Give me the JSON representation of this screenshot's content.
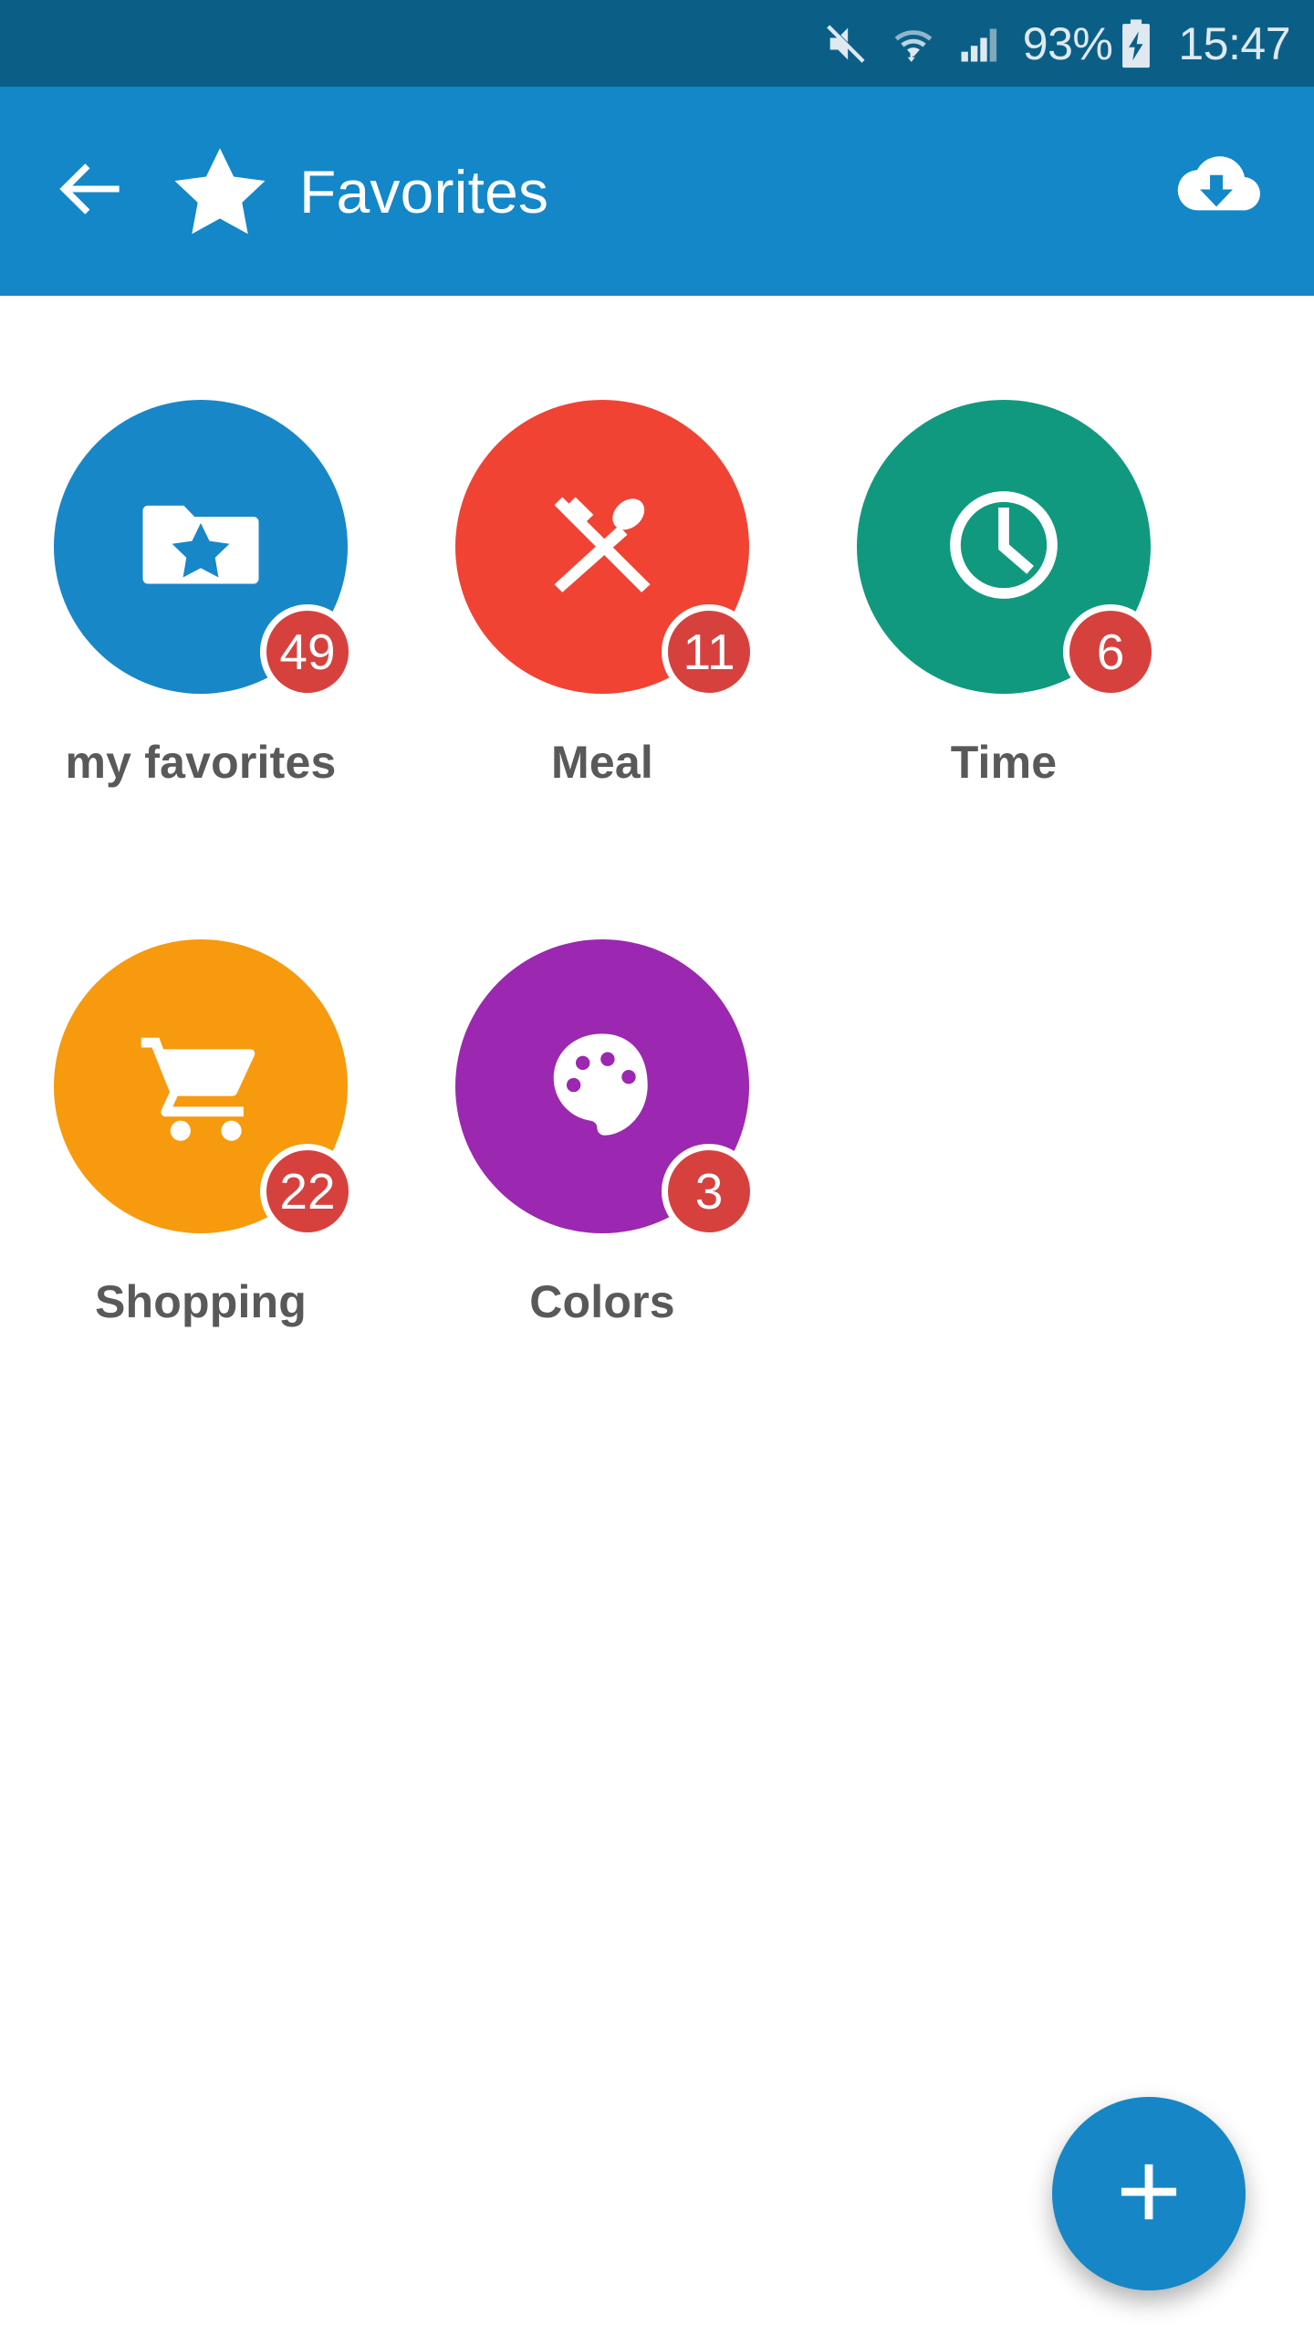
{
  "status_bar": {
    "background_color": "#0b5f87",
    "icons": [
      "mute-icon",
      "wifi-transfer-icon",
      "signal-bars-icon",
      "battery-charging-icon"
    ],
    "battery_percent": "93%",
    "clock": "15:47"
  },
  "app_bar": {
    "background_color": "#1387c8",
    "back_icon": "back-arrow-icon",
    "leading_icon": "star-icon",
    "title": "Favorites",
    "action_icon": "cloud-download-icon"
  },
  "grid": {
    "items": [
      {
        "label": "my favorites",
        "badge": "49",
        "color": "#1787c8",
        "icon": "folder-star-icon"
      },
      {
        "label": "Meal",
        "badge": "11",
        "color": "#f04334",
        "icon": "cutlery-icon"
      },
      {
        "label": "Time",
        "badge": "6",
        "color": "#11997f",
        "icon": "clock-icon"
      },
      {
        "label": "Shopping",
        "badge": "22",
        "color": "#f79a0e",
        "icon": "shopping-cart-icon"
      },
      {
        "label": "Colors",
        "badge": "3",
        "color": "#9c27b0",
        "icon": "paint-palette-icon"
      }
    ],
    "badge_color": "#d6413e",
    "label_color": "#595959"
  },
  "fab": {
    "icon": "plus-icon",
    "color": "#1786c6"
  }
}
